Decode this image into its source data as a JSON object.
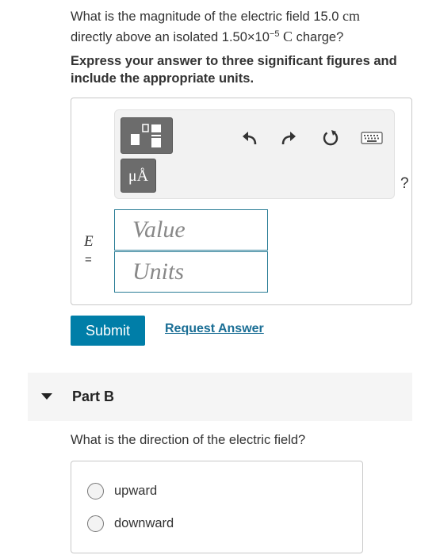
{
  "part_a": {
    "question": {
      "line1_pre": "What is the magnitude of the electric field 15.0 ",
      "line1_unit": "cm",
      "line2_pre": "directly above an isolated 1.50×10",
      "line2_exp": "−5",
      "line2_unit": "C",
      "line2_post": " charge?"
    },
    "instruction": "Express your answer to three significant figures and include the appropriate units.",
    "toolbar": {
      "templates_icon": "templates-icon",
      "units_label": "μÅ",
      "undo_icon": "undo-icon",
      "redo_icon": "redo-icon",
      "reset_icon": "reset-icon",
      "keyboard_icon": "keyboard-icon",
      "help_label": "?"
    },
    "variable": "E",
    "equals": "=",
    "value_placeholder": "Value",
    "units_placeholder": "Units",
    "submit_label": "Submit",
    "request_answer_label": "Request Answer"
  },
  "part_b": {
    "title": "Part B",
    "question": "What is the direction of the electric field?",
    "options": [
      "upward",
      "downward"
    ]
  },
  "colors": {
    "accent": "#007ea8",
    "link": "#1a6e95",
    "input_border": "#2a7d96",
    "toolbar_button": "#6c6c6c"
  }
}
